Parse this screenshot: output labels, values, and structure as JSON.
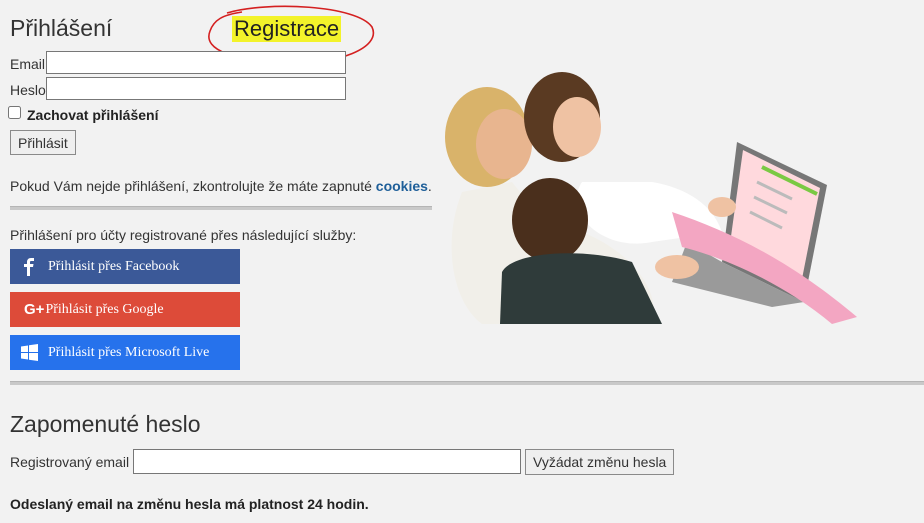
{
  "login": {
    "title": "Přihlášení",
    "register_link": "Registrace",
    "email_label": "Email",
    "password_label": "Heslo",
    "remember_label": "Zachovat přihlášení",
    "submit_label": "Přihlásit"
  },
  "cookies_notice": {
    "text": "Pokud Vám nejde přihlášení, zkontrolujte že máte zapnuté ",
    "link": "cookies",
    "end": "."
  },
  "social": {
    "heading": "Přihlášení pro účty registrované přes následující služby:",
    "buttons": [
      {
        "label": "Přihlásit přes Facebook",
        "color": "#3b5998",
        "icon": "facebook-icon"
      },
      {
        "label": "Přihlásit přes Google",
        "color": "#dd4b39",
        "icon": "google-plus-icon"
      },
      {
        "label": "Přihlásit přes Microsoft Live",
        "color": "#2672ec",
        "icon": "windows-icon"
      }
    ]
  },
  "forgot": {
    "title": "Zapomenuté heslo",
    "email_label": "Registrovaný email",
    "submit_label": "Vyžádat změnu hesla",
    "note": "Odeslaný email na změnu hesla má platnost 24 hodin."
  },
  "colors": {
    "highlight": "#f3f32a",
    "annotation_circle": "#d42020",
    "link": "#1f5f99"
  }
}
